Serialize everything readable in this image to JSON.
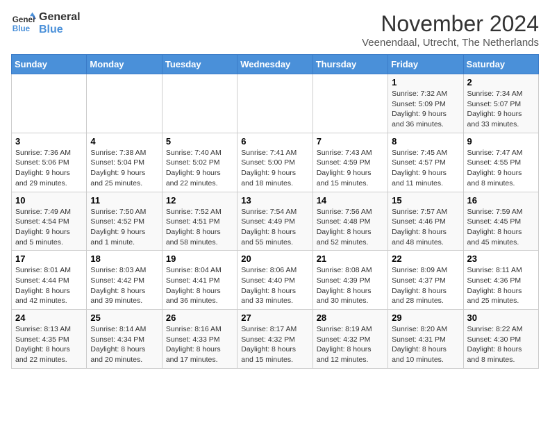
{
  "logo": {
    "line1": "General",
    "line2": "Blue"
  },
  "title": "November 2024",
  "subtitle": "Veenendaal, Utrecht, The Netherlands",
  "weekdays": [
    "Sunday",
    "Monday",
    "Tuesday",
    "Wednesday",
    "Thursday",
    "Friday",
    "Saturday"
  ],
  "weeks": [
    [
      {
        "day": "",
        "info": ""
      },
      {
        "day": "",
        "info": ""
      },
      {
        "day": "",
        "info": ""
      },
      {
        "day": "",
        "info": ""
      },
      {
        "day": "",
        "info": ""
      },
      {
        "day": "1",
        "info": "Sunrise: 7:32 AM\nSunset: 5:09 PM\nDaylight: 9 hours and 36 minutes."
      },
      {
        "day": "2",
        "info": "Sunrise: 7:34 AM\nSunset: 5:07 PM\nDaylight: 9 hours and 33 minutes."
      }
    ],
    [
      {
        "day": "3",
        "info": "Sunrise: 7:36 AM\nSunset: 5:06 PM\nDaylight: 9 hours and 29 minutes."
      },
      {
        "day": "4",
        "info": "Sunrise: 7:38 AM\nSunset: 5:04 PM\nDaylight: 9 hours and 25 minutes."
      },
      {
        "day": "5",
        "info": "Sunrise: 7:40 AM\nSunset: 5:02 PM\nDaylight: 9 hours and 22 minutes."
      },
      {
        "day": "6",
        "info": "Sunrise: 7:41 AM\nSunset: 5:00 PM\nDaylight: 9 hours and 18 minutes."
      },
      {
        "day": "7",
        "info": "Sunrise: 7:43 AM\nSunset: 4:59 PM\nDaylight: 9 hours and 15 minutes."
      },
      {
        "day": "8",
        "info": "Sunrise: 7:45 AM\nSunset: 4:57 PM\nDaylight: 9 hours and 11 minutes."
      },
      {
        "day": "9",
        "info": "Sunrise: 7:47 AM\nSunset: 4:55 PM\nDaylight: 9 hours and 8 minutes."
      }
    ],
    [
      {
        "day": "10",
        "info": "Sunrise: 7:49 AM\nSunset: 4:54 PM\nDaylight: 9 hours and 5 minutes."
      },
      {
        "day": "11",
        "info": "Sunrise: 7:50 AM\nSunset: 4:52 PM\nDaylight: 9 hours and 1 minute."
      },
      {
        "day": "12",
        "info": "Sunrise: 7:52 AM\nSunset: 4:51 PM\nDaylight: 8 hours and 58 minutes."
      },
      {
        "day": "13",
        "info": "Sunrise: 7:54 AM\nSunset: 4:49 PM\nDaylight: 8 hours and 55 minutes."
      },
      {
        "day": "14",
        "info": "Sunrise: 7:56 AM\nSunset: 4:48 PM\nDaylight: 8 hours and 52 minutes."
      },
      {
        "day": "15",
        "info": "Sunrise: 7:57 AM\nSunset: 4:46 PM\nDaylight: 8 hours and 48 minutes."
      },
      {
        "day": "16",
        "info": "Sunrise: 7:59 AM\nSunset: 4:45 PM\nDaylight: 8 hours and 45 minutes."
      }
    ],
    [
      {
        "day": "17",
        "info": "Sunrise: 8:01 AM\nSunset: 4:44 PM\nDaylight: 8 hours and 42 minutes."
      },
      {
        "day": "18",
        "info": "Sunrise: 8:03 AM\nSunset: 4:42 PM\nDaylight: 8 hours and 39 minutes."
      },
      {
        "day": "19",
        "info": "Sunrise: 8:04 AM\nSunset: 4:41 PM\nDaylight: 8 hours and 36 minutes."
      },
      {
        "day": "20",
        "info": "Sunrise: 8:06 AM\nSunset: 4:40 PM\nDaylight: 8 hours and 33 minutes."
      },
      {
        "day": "21",
        "info": "Sunrise: 8:08 AM\nSunset: 4:39 PM\nDaylight: 8 hours and 30 minutes."
      },
      {
        "day": "22",
        "info": "Sunrise: 8:09 AM\nSunset: 4:37 PM\nDaylight: 8 hours and 28 minutes."
      },
      {
        "day": "23",
        "info": "Sunrise: 8:11 AM\nSunset: 4:36 PM\nDaylight: 8 hours and 25 minutes."
      }
    ],
    [
      {
        "day": "24",
        "info": "Sunrise: 8:13 AM\nSunset: 4:35 PM\nDaylight: 8 hours and 22 minutes."
      },
      {
        "day": "25",
        "info": "Sunrise: 8:14 AM\nSunset: 4:34 PM\nDaylight: 8 hours and 20 minutes."
      },
      {
        "day": "26",
        "info": "Sunrise: 8:16 AM\nSunset: 4:33 PM\nDaylight: 8 hours and 17 minutes."
      },
      {
        "day": "27",
        "info": "Sunrise: 8:17 AM\nSunset: 4:32 PM\nDaylight: 8 hours and 15 minutes."
      },
      {
        "day": "28",
        "info": "Sunrise: 8:19 AM\nSunset: 4:32 PM\nDaylight: 8 hours and 12 minutes."
      },
      {
        "day": "29",
        "info": "Sunrise: 8:20 AM\nSunset: 4:31 PM\nDaylight: 8 hours and 10 minutes."
      },
      {
        "day": "30",
        "info": "Sunrise: 8:22 AM\nSunset: 4:30 PM\nDaylight: 8 hours and 8 minutes."
      }
    ]
  ]
}
